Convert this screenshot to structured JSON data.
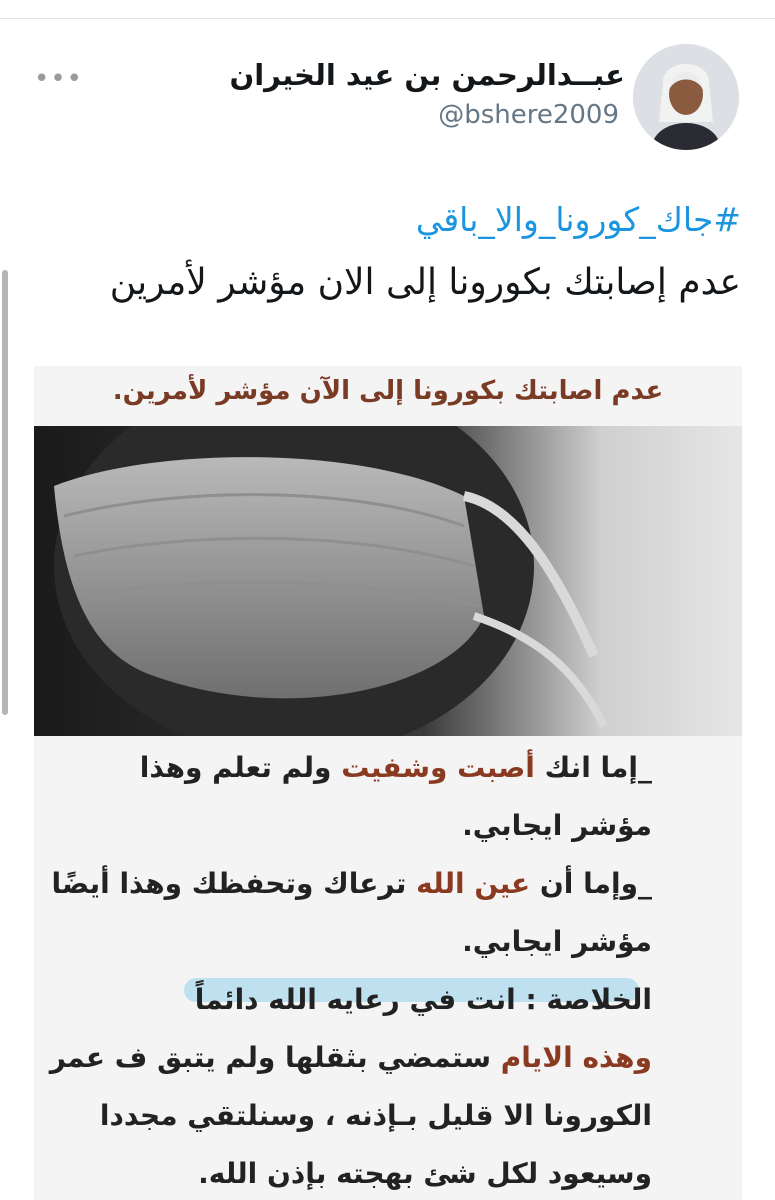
{
  "tweet": {
    "author_name": "عبــدالرحمن بن عيد الخيران",
    "handle": "@bshere2009",
    "more_icon": "more-dots-icon",
    "hashtag": "#جاك_كورونا_والا_باقي",
    "text": "عدم إصابتك بكورونا إلى الان مؤشر لأمرين"
  },
  "media": {
    "title": "عدم اصابتك بكورونا إلى الآن مؤشر لأمرين.",
    "lines": [
      {
        "pre": "_إما انك ",
        "hl": "أصبت وشفيت",
        "post": " ولم تعلم وهذا"
      },
      {
        "pre": "مؤشر ايجابي.",
        "hl": "",
        "post": ""
      },
      {
        "pre": "_وإما أن ",
        "hl": "عين الله",
        "post": " ترعاك وتحفظك وهذا أيضًا"
      },
      {
        "pre": "مؤشر ايجابي.",
        "hl": "",
        "post": ""
      },
      {
        "pre": "الخلاصة : انت في رعايه الله دائماً",
        "hl": "",
        "post": ""
      },
      {
        "pre": "",
        "hl": "وهذه الايام",
        "post": " ستمضي بثقلها ولم يتبق ف عمر"
      },
      {
        "pre": "الكورونا الا قليل بـإذنه ، وسنلتقي مجددا",
        "hl": "",
        "post": ""
      },
      {
        "pre": "وسيعود لكل شئ بهجته بإذن الله.",
        "hl": "",
        "post": ""
      }
    ]
  }
}
